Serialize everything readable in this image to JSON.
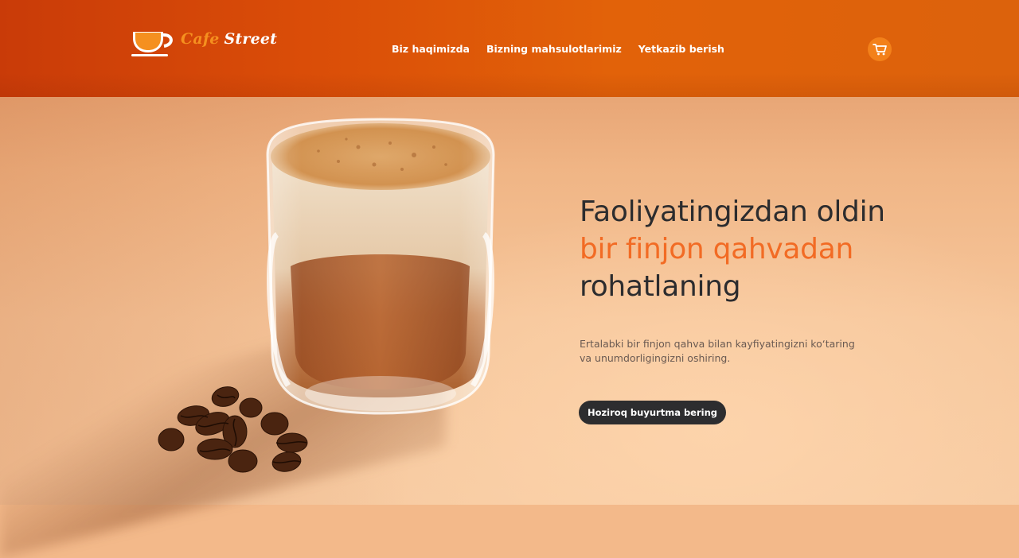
{
  "brand": {
    "word1": "Cafe",
    "word2": "Street",
    "logo_icon": "coffee-cup-icon"
  },
  "nav": {
    "items": [
      {
        "label": "Biz haqimizda"
      },
      {
        "label": "Bizning mahsulotlarimiz"
      },
      {
        "label": "Yetkazib berish"
      }
    ],
    "cart_icon": "cart-icon"
  },
  "hero": {
    "headline_line1": "Faoliyatingizdan oldin",
    "headline_line2": "bir finjon qahvadan",
    "headline_line3": "rohatlaning",
    "subtitle_line1": "Ertalabki bir finjon qahva bilan kayfiyatingizni ko‘taring",
    "subtitle_line2": "va unumdorligingizni oshiring.",
    "cta_label": "Hoziroq buyurtma bering",
    "image_icon": "coffee-glass-image"
  },
  "colors": {
    "header": "#dc5209",
    "accent": "#f26b24",
    "logo_accent": "#f5901f",
    "cart_bg": "#f3811a",
    "button_bg": "#2d2d2f",
    "text_dark": "#2c2c2e"
  }
}
